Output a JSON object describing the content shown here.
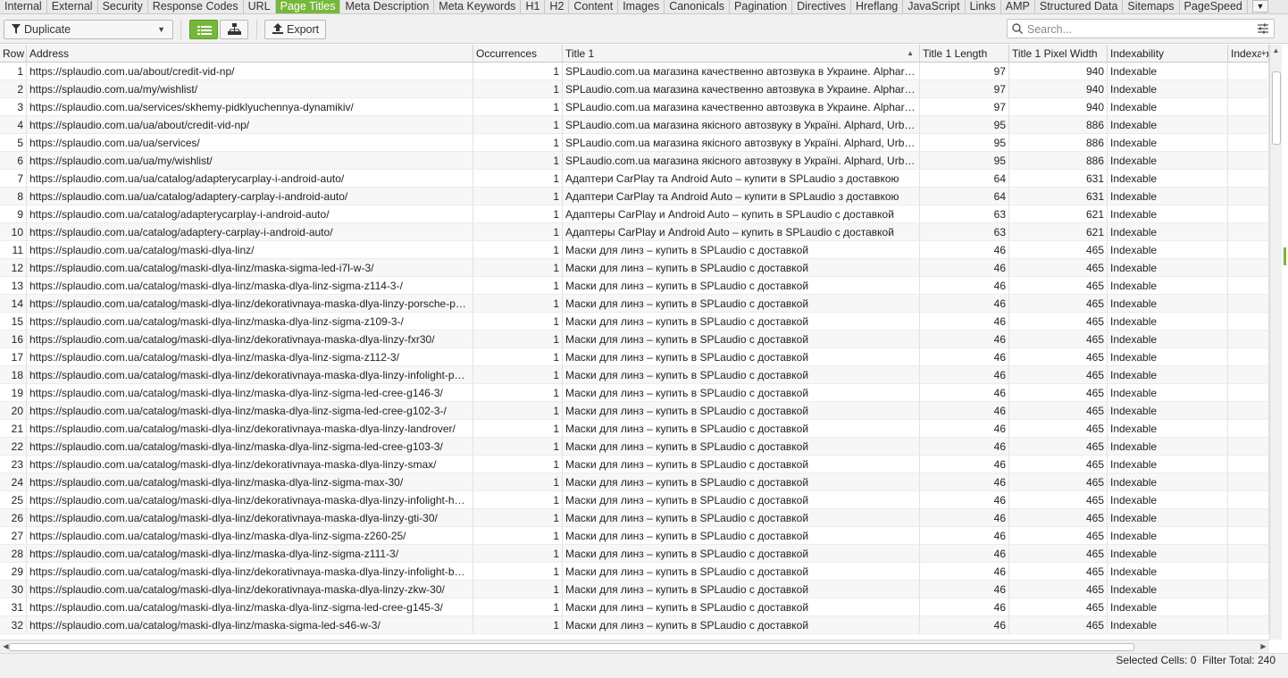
{
  "tabs": [
    "Internal",
    "External",
    "Security",
    "Response Codes",
    "URL",
    "Page Titles",
    "Meta Description",
    "Meta Keywords",
    "H1",
    "H2",
    "Content",
    "Images",
    "Canonicals",
    "Pagination",
    "Directives",
    "Hreflang",
    "JavaScript",
    "Links",
    "AMP",
    "Structured Data",
    "Sitemaps",
    "PageSpeed",
    "C"
  ],
  "active_tab": "Page Titles",
  "toolbar": {
    "filter_value": "Duplicate",
    "export_label": "Export",
    "search_placeholder": "Search..."
  },
  "table": {
    "columns": [
      "Row",
      "Address",
      "Occurrences",
      "Title 1",
      "Title 1 Length",
      "Title 1 Pixel Width",
      "Indexability",
      "Indexab"
    ],
    "rows": [
      [
        "1",
        "https://splaudio.com.ua/about/credit-vid-np/",
        "1",
        "SPLaudio.com.ua магазина качественно автозвука в Украине. Alphard, Urban, Kicx, Hertz, Prology",
        "97",
        "940",
        "Indexable",
        ""
      ],
      [
        "2",
        "https://splaudio.com.ua/my/wishlist/",
        "1",
        "SPLaudio.com.ua магазина качественно автозвука в Украине. Alphard, Urban, Kicx, Hertz, Prology",
        "97",
        "940",
        "Indexable",
        ""
      ],
      [
        "3",
        "https://splaudio.com.ua/services/skhemy-pidklyuchennya-dynamikiv/",
        "1",
        "SPLaudio.com.ua магазина качественно автозвука в Украине. Alphard, Urban, Kicx, Hertz, Prology",
        "97",
        "940",
        "Indexable",
        ""
      ],
      [
        "4",
        "https://splaudio.com.ua/ua/about/credit-vid-np/",
        "1",
        "SPLaudio.com.ua магазина якісного автозвуку в Україні. Alphard, Urban, Kicx, Hertz, Prology",
        "95",
        "886",
        "Indexable",
        ""
      ],
      [
        "5",
        "https://splaudio.com.ua/ua/services/",
        "1",
        "SPLaudio.com.ua магазина якісного автозвуку в Україні. Alphard, Urban, Kicx, Hertz, Prology",
        "95",
        "886",
        "Indexable",
        ""
      ],
      [
        "6",
        "https://splaudio.com.ua/ua/my/wishlist/",
        "1",
        "SPLaudio.com.ua магазина якісного автозвуку в Україні. Alphard, Urban, Kicx, Hertz, Prology",
        "95",
        "886",
        "Indexable",
        ""
      ],
      [
        "7",
        "https://splaudio.com.ua/ua/catalog/adapterycarplay-i-android-auto/",
        "1",
        "Адаптери CarPlay та Android Auto – купити в SPLaudio з доставкою",
        "64",
        "631",
        "Indexable",
        ""
      ],
      [
        "8",
        "https://splaudio.com.ua/ua/catalog/adaptery-carplay-i-android-auto/",
        "1",
        "Адаптери CarPlay та Android Auto – купити в SPLaudio з доставкою",
        "64",
        "631",
        "Indexable",
        ""
      ],
      [
        "9",
        "https://splaudio.com.ua/catalog/adapterycarplay-i-android-auto/",
        "1",
        "Адаптеры CarPlay и Android Auto – купить в SPLaudio с доставкой",
        "63",
        "621",
        "Indexable",
        ""
      ],
      [
        "10",
        "https://splaudio.com.ua/catalog/adaptery-carplay-i-android-auto/",
        "1",
        "Адаптеры CarPlay и Android Auto – купить в SPLaudio с доставкой",
        "63",
        "621",
        "Indexable",
        ""
      ],
      [
        "11",
        "https://splaudio.com.ua/catalog/maski-dlya-linz/",
        "1",
        "Маски для линз – купить в SPLaudio с доставкой",
        "46",
        "465",
        "Indexable",
        ""
      ],
      [
        "12",
        "https://splaudio.com.ua/catalog/maski-dlya-linz/maska-sigma-led-i7l-w-3/",
        "1",
        "Маски для линз – купить в SPLaudio с доставкой",
        "46",
        "465",
        "Indexable",
        ""
      ],
      [
        "13",
        "https://splaudio.com.ua/catalog/maski-dlya-linz/maska-dlya-linz-sigma-z114-3-/",
        "1",
        "Маски для линз – купить в SPLaudio с доставкой",
        "46",
        "465",
        "Indexable",
        ""
      ],
      [
        "14",
        "https://splaudio.com.ua/catalog/maski-dlya-linz/dekorativnaya-maska-dlya-linzy-porsche-panamera/",
        "1",
        "Маски для линз – купить в SPLaudio с доставкой",
        "46",
        "465",
        "Indexable",
        ""
      ],
      [
        "15",
        "https://splaudio.com.ua/catalog/maski-dlya-linz/maska-dlya-linz-sigma-z109-3-/",
        "1",
        "Маски для линз – купить в SPLaudio с доставкой",
        "46",
        "465",
        "Indexable",
        ""
      ],
      [
        "16",
        "https://splaudio.com.ua/catalog/maski-dlya-linz/dekorativnaya-maska-dlya-linzy-fxr30/",
        "1",
        "Маски для линз – купить в SPLaudio с доставкой",
        "46",
        "465",
        "Indexable",
        ""
      ],
      [
        "17",
        "https://splaudio.com.ua/catalog/maski-dlya-linz/maska-dlya-linz-sigma-z112-3/",
        "1",
        "Маски для линз – купить в SPLaudio с доставкой",
        "46",
        "465",
        "Indexable",
        ""
      ],
      [
        "18",
        "https://splaudio.com.ua/catalog/maski-dlya-linz/dekorativnaya-maska-dlya-linzy-infolight-panamera/",
        "1",
        "Маски для линз – купить в SPLaudio с доставкой",
        "46",
        "465",
        "Indexable",
        ""
      ],
      [
        "19",
        "https://splaudio.com.ua/catalog/maski-dlya-linz/maska-dlya-linz-sigma-led-cree-g146-3/",
        "1",
        "Маски для линз – купить в SPLaudio с доставкой",
        "46",
        "465",
        "Indexable",
        ""
      ],
      [
        "20",
        "https://splaudio.com.ua/catalog/maski-dlya-linz/maska-dlya-linz-sigma-led-cree-g102-3-/",
        "1",
        "Маски для линз – купить в SPLaudio с доставкой",
        "46",
        "465",
        "Indexable",
        ""
      ],
      [
        "21",
        "https://splaudio.com.ua/catalog/maski-dlya-linz/dekorativnaya-maska-dlya-linzy-landrover/",
        "1",
        "Маски для линз – купить в SPLaudio с доставкой",
        "46",
        "465",
        "Indexable",
        ""
      ],
      [
        "22",
        "https://splaudio.com.ua/catalog/maski-dlya-linz/maska-dlya-linz-sigma-led-cree-g103-3/",
        "1",
        "Маски для линз – купить в SPLaudio с доставкой",
        "46",
        "465",
        "Indexable",
        ""
      ],
      [
        "23",
        "https://splaudio.com.ua/catalog/maski-dlya-linz/dekorativnaya-maska-dlya-linzy-smax/",
        "1",
        "Маски для линз – купить в SPLaudio с доставкой",
        "46",
        "465",
        "Indexable",
        ""
      ],
      [
        "24",
        "https://splaudio.com.ua/catalog/maski-dlya-linz/maska-dlya-linz-sigma-max-30/",
        "1",
        "Маски для линз – купить в SPLaudio с доставкой",
        "46",
        "465",
        "Indexable",
        ""
      ],
      [
        "25",
        "https://splaudio.com.ua/catalog/maski-dlya-linz/dekorativnaya-maska-dlya-linzy-infolight-hella/",
        "1",
        "Маски для линз – купить в SPLaudio с доставкой",
        "46",
        "465",
        "Indexable",
        ""
      ],
      [
        "26",
        "https://splaudio.com.ua/catalog/maski-dlya-linz/dekorativnaya-maska-dlya-linzy-gti-30/",
        "1",
        "Маски для линз – купить в SPLaudio с доставкой",
        "46",
        "465",
        "Indexable",
        ""
      ],
      [
        "27",
        "https://splaudio.com.ua/catalog/maski-dlya-linz/maska-dlya-linz-sigma-z260-25/",
        "1",
        "Маски для линз – купить в SPLaudio с доставкой",
        "46",
        "465",
        "Indexable",
        ""
      ],
      [
        "28",
        "https://splaudio.com.ua/catalog/maski-dlya-linz/maska-dlya-linz-sigma-z111-3/",
        "1",
        "Маски для линз – купить в SPLaudio с доставкой",
        "46",
        "465",
        "Indexable",
        ""
      ],
      [
        "29",
        "https://splaudio.com.ua/catalog/maski-dlya-linz/dekorativnaya-maska-dlya-linzy-infolight-bmw/",
        "1",
        "Маски для линз – купить в SPLaudio с доставкой",
        "46",
        "465",
        "Indexable",
        ""
      ],
      [
        "30",
        "https://splaudio.com.ua/catalog/maski-dlya-linz/dekorativnaya-maska-dlya-linzy-zkw-30/",
        "1",
        "Маски для линз – купить в SPLaudio с доставкой",
        "46",
        "465",
        "Indexable",
        ""
      ],
      [
        "31",
        "https://splaudio.com.ua/catalog/maski-dlya-linz/maska-dlya-linz-sigma-led-cree-g145-3/",
        "1",
        "Маски для линз – купить в SPLaudio с доставкой",
        "46",
        "465",
        "Indexable",
        ""
      ],
      [
        "32",
        "https://splaudio.com.ua/catalog/maski-dlya-linz/maska-sigma-led-s46-w-3/",
        "1",
        "Маски для линз – купить в SPLaudio с доставкой",
        "46",
        "465",
        "Indexable",
        ""
      ]
    ]
  },
  "status": {
    "selected_label": "Selected Cells:",
    "selected_value": "0",
    "filter_label": "Filter Total:",
    "filter_value": "240"
  },
  "colors": {
    "accent": "#76b83a"
  }
}
